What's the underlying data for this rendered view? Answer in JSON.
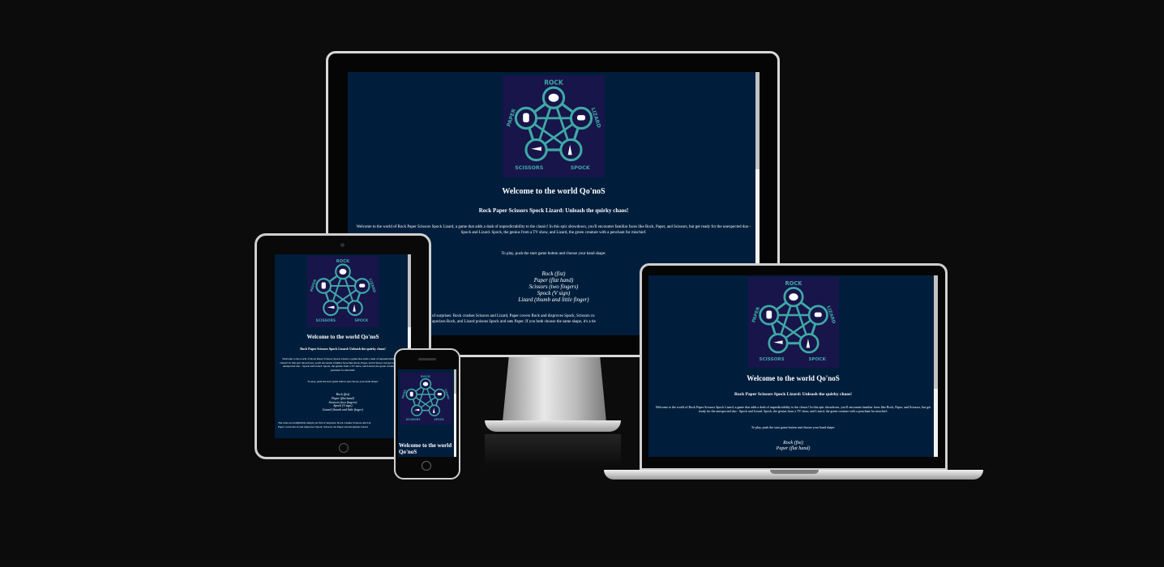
{
  "site": {
    "logo_labels": [
      "ROCK",
      "LIZARD",
      "SPOCK",
      "SCISSORS",
      "PAPER"
    ],
    "heading": "Welcome to the world Qo'noS",
    "subheading": "Rock Paper Scissors Spock Lizard: Unleash the quirky chaos!",
    "intro": "Welcome to the world of Rock Paper Scissors Spock Lizard, a game that adds a dash of unpredictability to the classic! In this epic showdown, you'll encounter familiar faces like Rock, Paper, and Scissors, but get ready for the unexpected duo - Spock and Lizard. Spock, the genius from a TV show, and Lizard, the green creature with a penchant for mischief.",
    "instruction": "To play, push the start game button and choose your hand shape:",
    "shapes": [
      "Rock (fist)",
      "Paper (flat hand)",
      "Scissors (two fingers)",
      "Spock (V sign)",
      "Lizard (thumb and little finger)"
    ],
    "rules_fragment_1": "of surprises: Rock crushes Scissors and Lizard, Paper covers Rock and disproves Spock, Scissors cu",
    "rules_fragment_2": "aporizes Rock, and Lizard poisons Spock and eats Paper. If you both choose the same shape, it's a tie",
    "tablet_rules_1": "The rules are delightfully simple yet full of surprises: Rock crushes Scissors and Liz",
    "tablet_rules_2": "Paper covers Rock and disproves Spock, Scissors cut Paper and decapitate Lizard",
    "phone_heading_1": "Welcome to the world",
    "phone_heading_2": "Qo'noS",
    "laptop_shape_2_fragment": "Paper (flat hand)"
  },
  "colors": {
    "page_bg": "#0c0c0c",
    "screen_bg": "#001e3c",
    "logo_bg": "#17154a",
    "logo_ring": "#3fa9a5"
  }
}
